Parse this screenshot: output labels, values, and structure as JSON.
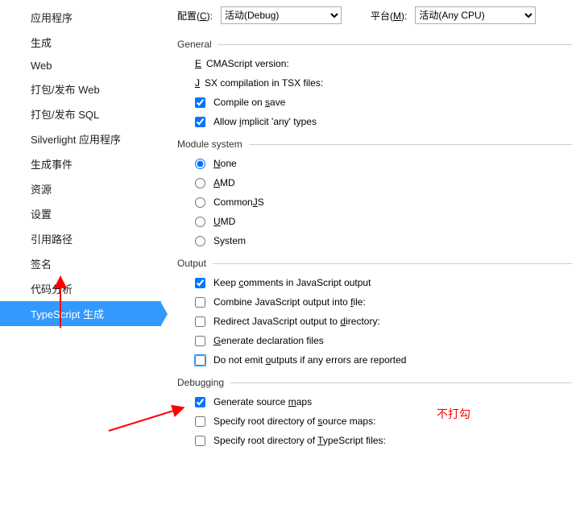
{
  "top": {
    "config_label_prefix": "配置(",
    "config_mnemonic": "C",
    "config_label_suffix": "):",
    "config_value": "活动(Debug)",
    "platform_label_prefix": "平台(",
    "platform_mnemonic": "M",
    "platform_label_suffix": "):",
    "platform_value": "活动(Any CPU)"
  },
  "sidebar": {
    "items": [
      {
        "label": "应用程序"
      },
      {
        "label": "生成"
      },
      {
        "label": "Web"
      },
      {
        "label": "打包/发布 Web"
      },
      {
        "label": "打包/发布 SQL"
      },
      {
        "label": "Silverlight 应用程序"
      },
      {
        "label": "生成事件"
      },
      {
        "label": "资源"
      },
      {
        "label": "设置"
      },
      {
        "label": "引用路径"
      },
      {
        "label": "签名"
      },
      {
        "label": "代码分析"
      },
      {
        "label": "TypeScript 生成"
      }
    ],
    "selected_index": 12
  },
  "groups": {
    "general": {
      "title": "General",
      "ecma_prefix": "",
      "ecma_u": "E",
      "ecma_rest": "CMAScript version:",
      "jsx_prefix": "",
      "jsx_u": "J",
      "jsx_rest": "SX compilation in TSX files:",
      "compile_prefix": "Compile on ",
      "compile_u": "s",
      "compile_rest": "ave",
      "implicit_prefix": "Allow ",
      "implicit_u": "i",
      "implicit_rest": "mplicit 'any' types"
    },
    "module": {
      "title": "Module system",
      "none_u": "N",
      "none_rest": "one",
      "amd_u": "A",
      "amd_rest": "MD",
      "cjs_prefix": "Common",
      "cjs_u": "J",
      "cjs_rest": "S",
      "umd_u": "U",
      "umd_rest": "MD",
      "system": "System"
    },
    "output": {
      "title": "Output",
      "keep_prefix": "Keep ",
      "keep_u": "c",
      "keep_rest": "omments in JavaScript output",
      "combine_prefix": "Combine JavaScript output into ",
      "combine_u": "f",
      "combine_rest": "ile:",
      "redirect_prefix": "Redirect JavaScript output to ",
      "redirect_u": "d",
      "redirect_rest": "irectory:",
      "decl_u": "G",
      "decl_rest": "enerate declaration files",
      "noemit_prefix": "Do not emit ",
      "noemit_u": "o",
      "noemit_rest": "utputs if any errors are reported"
    },
    "debugging": {
      "title": "Debugging",
      "maps_prefix": "Generate source ",
      "maps_u": "m",
      "maps_rest": "aps",
      "root_src_prefix": "Specify root directory of ",
      "root_src_u": "s",
      "root_src_rest": "ource maps:",
      "root_ts_prefix": "Specify root directory of ",
      "root_ts_u": "T",
      "root_ts_rest": "ypeScript files:"
    }
  },
  "annotations": {
    "no_check_label": "不打勾"
  }
}
